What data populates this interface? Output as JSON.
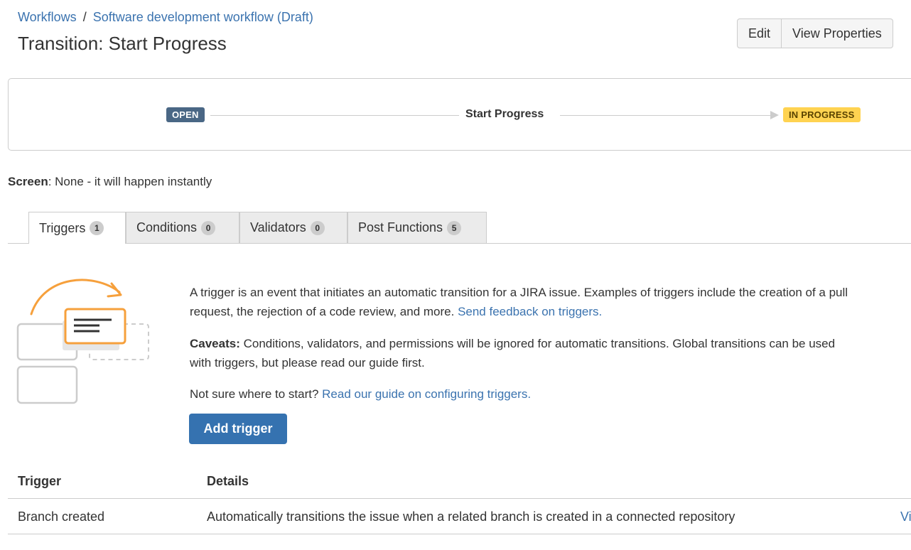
{
  "breadcrumb": {
    "root": "Workflows",
    "separator": "/",
    "current": "Software development workflow (Draft)"
  },
  "header": {
    "title": "Transition: Start Progress",
    "edit_label": "Edit",
    "view_properties_label": "View Properties"
  },
  "diagram": {
    "from_status": "OPEN",
    "transition_name": "Start Progress",
    "to_status": "IN PROGRESS"
  },
  "screen": {
    "label": "Screen",
    "value": ": None - it will happen instantly"
  },
  "tabs": [
    {
      "label": "Triggers",
      "count": "1",
      "active": true
    },
    {
      "label": "Conditions",
      "count": "0",
      "active": false
    },
    {
      "label": "Validators",
      "count": "0",
      "active": false
    },
    {
      "label": "Post Functions",
      "count": "5",
      "active": false
    }
  ],
  "description": {
    "intro_line1": "A trigger is an event that initiates an automatic transition for a JIRA issue. Examples of triggers include the creation of a pull",
    "intro_line2": "request, the rejection of a code review, and more.",
    "feedback_link": "Send feedback on triggers.",
    "caveats_label": "Caveats:",
    "caveats_line1": " Conditions, validators, and permissions will be ignored for automatic transitions. Global transitions can be used",
    "caveats_line2": "with triggers, but please read our guide first.",
    "start_text": "Not sure where to start?",
    "guide_link": "Read our guide on configuring triggers."
  },
  "add_trigger_label": "Add trigger",
  "table": {
    "headers": [
      "Trigger",
      "Details"
    ],
    "rows": [
      {
        "trigger": "Branch created",
        "details": "Automatically transitions the issue when a related branch is created in a connected repository",
        "action": "View"
      }
    ]
  },
  "colors": {
    "link": "#3b73af",
    "primary_button": "#3572b0",
    "status_open": "#4a6785",
    "status_in_progress": "#ffd351",
    "illustration_orange": "#f6a03c"
  }
}
